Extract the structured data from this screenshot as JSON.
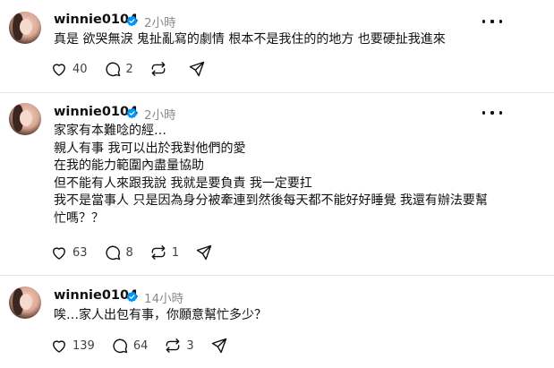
{
  "posts": [
    {
      "username": "winnie0104",
      "time": "2小時",
      "text": "真是 欲哭無淚 鬼扯亂寫的劇情 根本不是我住的的地方 也要硬扯我進來",
      "likes": "40",
      "comments": "2",
      "reposts": ""
    },
    {
      "username": "winnie0104",
      "time": "2小時",
      "text": "家家有本難唸的經…\n親人有事 我可以出於我對他們的愛\n在我的能力範圍內盡量協助\n但不能有人來跟我說 我就是要負責 我一定要扛\n我不是當事人 只是因為身分被牽連到然後每天都不能好好睡覺 我還有辦法要幫\n忙嗎？？",
      "likes": "63",
      "comments": "8",
      "reposts": "1"
    },
    {
      "username": "winnie0104",
      "time": "14小時",
      "text": "唉…家人出包有事，你願意幫忙多少？",
      "likes": "139",
      "comments": "64",
      "reposts": "3"
    }
  ],
  "colors": {
    "verified": "#0095f6",
    "muted": "#8a8a8a",
    "divider": "#e6e6e6"
  },
  "icons": [
    "heart-icon",
    "comment-icon",
    "repost-icon",
    "share-icon",
    "more-icon",
    "verified-badge-icon"
  ]
}
